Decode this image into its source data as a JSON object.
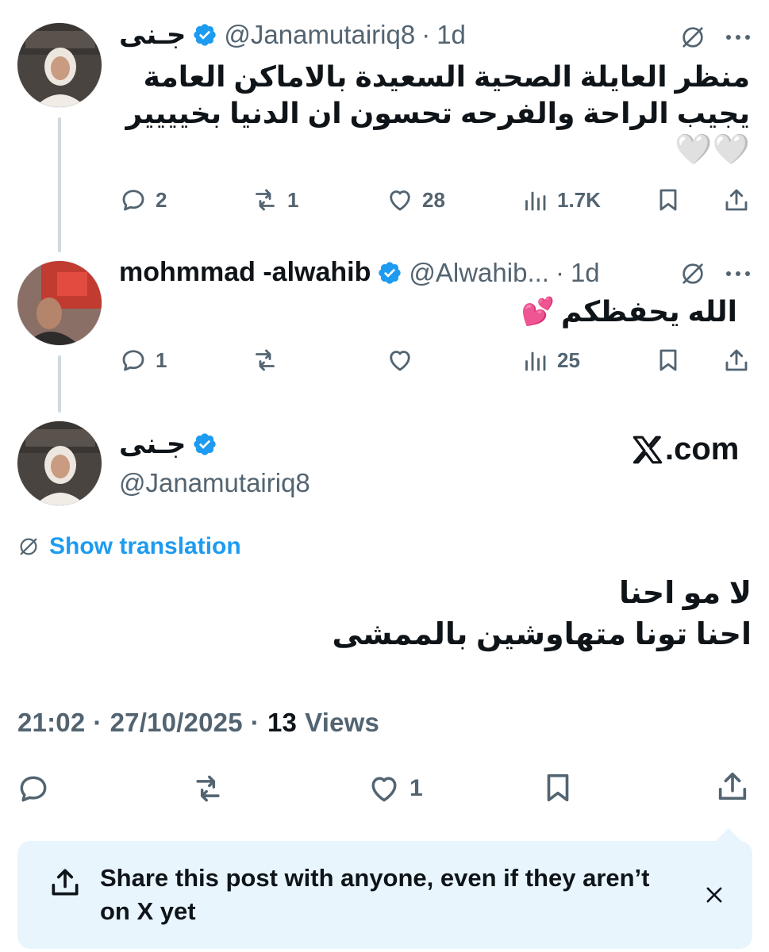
{
  "tweets": [
    {
      "name": "جـنى",
      "handle": "@Janamutairiq8",
      "time": "1d",
      "text_line1": "منظر العايلة الصحية السعيدة بالاماكن العامة",
      "text_line2": "يجيب الراحة والفرحه تحسون ان الدنيا بخيييير",
      "emoji": "🤍🤍",
      "replies": "2",
      "reposts": "1",
      "likes": "28",
      "views": "1.7K"
    },
    {
      "name": "mohmmad -alwahib",
      "handle": "@Alwahib...",
      "time": "1d",
      "text": "الله يحفظكم",
      "emoji": "💕",
      "replies": "1",
      "reposts": "",
      "likes": "",
      "views": "25"
    }
  ],
  "main_tweet": {
    "name": "جـنى",
    "handle": "@Janamutairiq8",
    "source": ".com",
    "show_translation": "Show translation",
    "text_line1": "لا مو احنا",
    "text_line2": "احنا تونا متهاوشين بالممشى",
    "time": "21:02",
    "date": "27/10/2025",
    "views_count": "13",
    "views_label": "Views",
    "likes": "1"
  },
  "share_prompt": {
    "text": "Share this post with anyone, even if they aren’t on X yet"
  },
  "separators": {
    "dot": "·"
  },
  "colors": {
    "accent": "#1d9bf0",
    "muted": "#536471",
    "text": "#0f1419",
    "share_bg": "#e8f5fd"
  }
}
